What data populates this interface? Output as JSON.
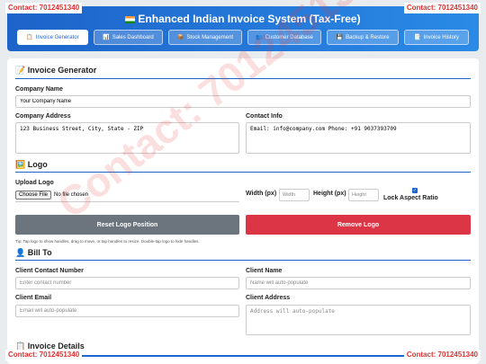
{
  "contact": {
    "top_left": "Contact: 7012451340",
    "top_right": "Contact: 7012451340",
    "bottom_left": "Contact: 7012451340",
    "bottom_right": "Contact: 7012451340"
  },
  "watermark": "Contact: 7012451340",
  "header": {
    "title": "Enhanced Indian Invoice System (Tax-Free)"
  },
  "nav": [
    {
      "label": "Invoice Generator",
      "icon": "📋",
      "active": true
    },
    {
      "label": "Sales Dashboard",
      "icon": "📊",
      "active": false
    },
    {
      "label": "Stock Management",
      "icon": "📦",
      "active": false
    },
    {
      "label": "Customer Database",
      "icon": "👥",
      "active": false
    },
    {
      "label": "Backup & Restore",
      "icon": "💾",
      "active": false
    },
    {
      "label": "Invoice History",
      "icon": "📑",
      "active": false
    }
  ],
  "invoice_generator": {
    "title": "Invoice Generator",
    "title_icon": "📝",
    "company_name_label": "Company Name",
    "company_name_value": "Your Company Name",
    "company_address_label": "Company Address",
    "company_address_value": "123 Business Street, City, State - ZIP",
    "contact_info_label": "Contact Info",
    "contact_info_value": "Email: info@company.com Phone: +91 9037393709"
  },
  "logo": {
    "title": "Logo",
    "title_icon": "🖼️",
    "upload_label": "Upload Logo",
    "choose_file": "Choose File",
    "no_file": "No file chosen",
    "width_label": "Width (px)",
    "width_placeholder": "Width",
    "height_label": "Height (px)",
    "height_placeholder": "Height",
    "lock_label": "Lock Aspect Ratio",
    "reset_button": "Reset Logo Position",
    "remove_button": "Remove Logo",
    "tip": "Tip: Tap logo to show handles, drag to move, or tap handles to resize. Double-tap logo to hide handles."
  },
  "bill_to": {
    "title": "Bill To",
    "title_icon": "👤",
    "client_contact_label": "Client Contact Number",
    "client_contact_placeholder": "Enter contact number",
    "client_name_label": "Client Name",
    "client_name_placeholder": "Name will auto-populate",
    "client_email_label": "Client Email",
    "client_email_placeholder": "Email will auto-populate",
    "client_address_label": "Client Address",
    "client_address_placeholder": "Address will auto-populate"
  },
  "invoice_details": {
    "title": "Invoice Details",
    "title_icon": "📋"
  },
  "colors": {
    "primary": "#1d63c9",
    "reset_button": "#6c757d",
    "remove_button": "#dc3545",
    "contact_text": "#e03131"
  }
}
